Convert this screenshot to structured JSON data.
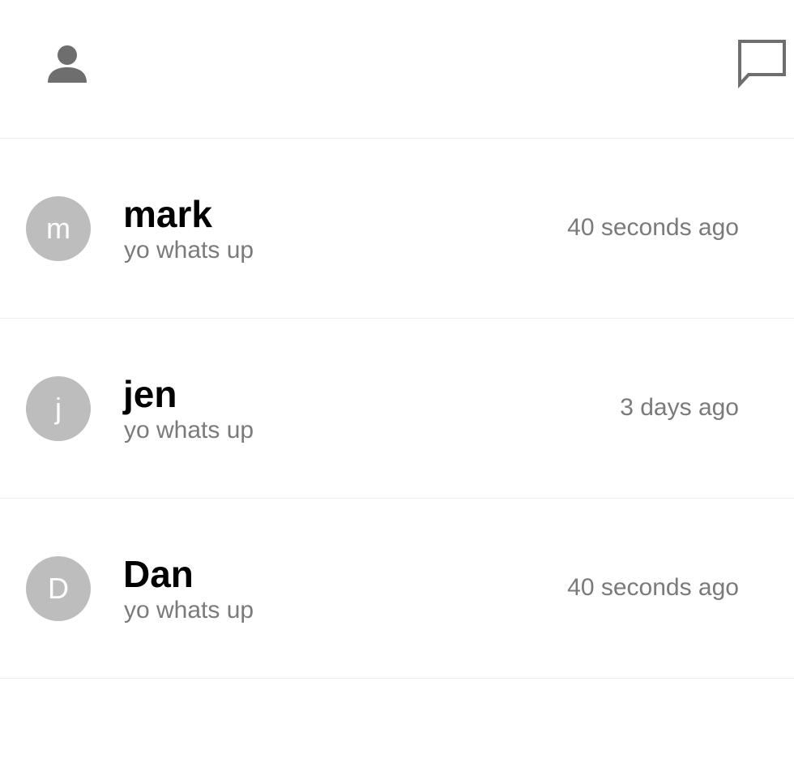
{
  "header": {
    "profile_icon": "person-icon",
    "compose_icon": "chat-bubble-icon",
    "icon_color": "#6e6e6e"
  },
  "conversations": [
    {
      "initial": "m",
      "name": "mark",
      "preview": "yo whats up",
      "time": "40 seconds ago"
    },
    {
      "initial": "j",
      "name": "jen",
      "preview": "yo whats up",
      "time": "3 days ago"
    },
    {
      "initial": "D",
      "name": "Dan",
      "preview": "yo whats up",
      "time": "40 seconds ago"
    }
  ],
  "colors": {
    "avatar_bg": "#bdbdbd",
    "secondary_text": "#7a7a7a",
    "divider": "#efefef"
  }
}
